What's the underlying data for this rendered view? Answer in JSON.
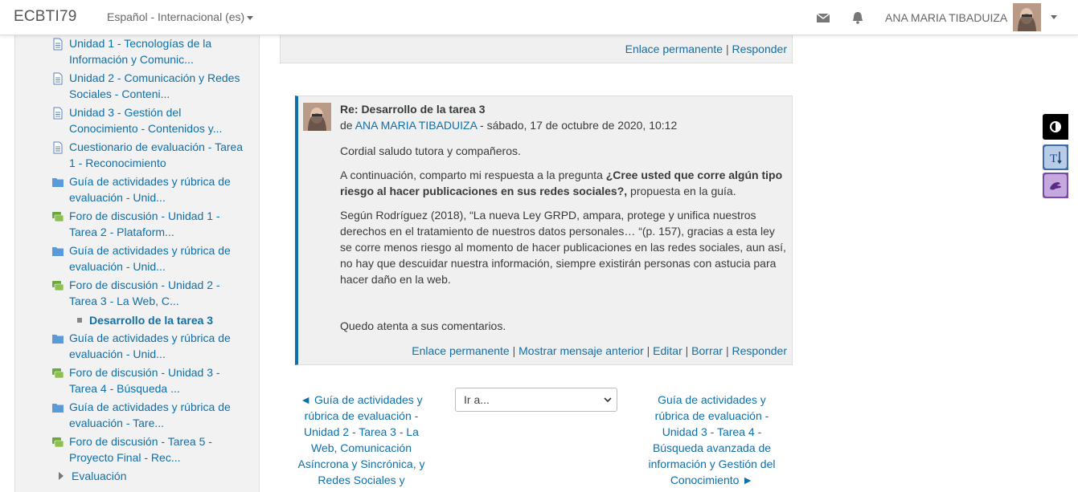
{
  "navbar": {
    "brand": "ECBTI79",
    "language": "Español - Internacional (es)",
    "username": "ANA MARIA TIBADUIZA"
  },
  "sidebar": {
    "items": [
      {
        "label": "Unidad 1 - Tecnologías de la Información y Comunic...",
        "icon": "page-icon"
      },
      {
        "label": "Unidad 2 - Comunicación y Redes Sociales - Conteni...",
        "icon": "page-icon"
      },
      {
        "label": "Unidad 3 - Gestión del Conocimiento - Contenidos y...",
        "icon": "page-icon"
      },
      {
        "label": "Cuestionario de evaluación - Tarea 1 - Reconocimiento",
        "icon": "page-icon"
      },
      {
        "label": "Guía de actividades y rúbrica de evaluación - Unid...",
        "icon": "folder-icon"
      },
      {
        "label": "Foro de discusión - Unidad 1 - Tarea 2 - Plataform...",
        "icon": "forum-icon"
      },
      {
        "label": "Guía de actividades y rúbrica de evaluación - Unid...",
        "icon": "folder-icon"
      },
      {
        "label": "Foro de discusión - Unidad 2 - Tarea 3 - La Web, C...",
        "icon": "forum-icon"
      },
      {
        "label": "Guía de actividades y rúbrica de evaluación - Unid...",
        "icon": "folder-icon"
      },
      {
        "label": "Foro de discusión - Unidad 3 - Tarea 4 - Búsqueda ...",
        "icon": "forum-icon"
      },
      {
        "label": "Guía de actividades y rúbrica de evaluación - Tare...",
        "icon": "folder-icon"
      },
      {
        "label": "Foro de discusión - Tarea 5 - Proyecto Final - Rec...",
        "icon": "forum-icon"
      }
    ],
    "current": "Desarrollo de la tarea 3",
    "evaluation": "Evaluación"
  },
  "prev_post": {
    "permalink": "Enlace permanente",
    "reply": "Responder"
  },
  "post": {
    "subject": "Re: Desarrollo de la tarea 3",
    "by_prefix": "de",
    "author": "ANA MARIA TIBADUIZA",
    "date": " - sábado, 17 de octubre de 2020, 10:12",
    "greeting": "Cordial saludo tutora y compañeros.",
    "p2_start": "A continuación, comparto mi respuesta a la pregunta ",
    "p2_bold": "¿Cree usted que corre algún tipo riesgo al hacer publicaciones en sus redes sociales?,",
    "p2_end": " propuesta en la guía.",
    "p3": "Según Rodríguez (2018), “La nueva Ley GRPD, ampara, protege y unifica nuestros derechos en el tratamiento de nuestros datos personales… “(p. 157), gracias a esta ley se corre menos riesgo al momento de hacer publicaciones en las redes sociales, aun así, no hay que descuidar nuestra información, siempre existirán personas con astucia para hacer daño en la web.",
    "closing": "Quedo atenta a sus comentarios.",
    "links": {
      "permalink": "Enlace permanente",
      "show_parent": "Mostrar mensaje anterior",
      "edit": "Editar",
      "delete": "Borrar",
      "reply": "Responder"
    }
  },
  "bottom_nav": {
    "prev": "◄ Guía de actividades y rúbrica de evaluación - Unidad 2 - Tarea 3 - La Web, Comunicación Asíncrona y Sincrónica, y Redes Sociales y",
    "jump_placeholder": "Ir a...",
    "next": "Guía de actividades y rúbrica de evaluación - Unidad 3 - Tarea 4 - Búsqueda avanzada de información y Gestión del Conocimiento ►"
  },
  "colors": {
    "link": "#0f6fa8",
    "post_bg": "#f0f0f0",
    "sidebar_bg": "#f2f2f2"
  }
}
